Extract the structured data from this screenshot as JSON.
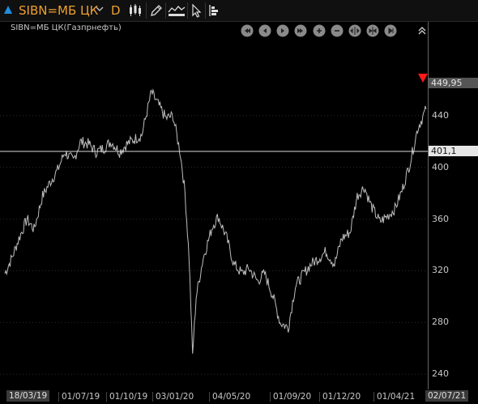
{
  "toolbar": {
    "symbol": "SIBN=МБ ЦК",
    "period": "D",
    "icons": [
      "chevron-down-icon",
      "candlestick-icon",
      "pencil-icon",
      "indicators-icon",
      "cursor-icon",
      "chart-settings-icon"
    ]
  },
  "legend": "SIBN=МБ ЦК(Газпрнефть)",
  "nav_icons": [
    "scroll-start-icon",
    "scroll-left-icon",
    "scroll-right-icon",
    "scroll-end-icon",
    "zoom-in-icon",
    "zoom-out-icon",
    "fit-width-icon",
    "compress-icon",
    "step-end-icon",
    "collapse-up-icon"
  ],
  "price": {
    "last": "449,95",
    "crosshair": "401,1"
  },
  "colors": {
    "accent": "#f0a030",
    "series": "#bdbdbd",
    "last_marker": "#ff1a1a",
    "crosshair": "#d8d8d8"
  },
  "chart_data": {
    "type": "line",
    "title": "SIBN=МБ ЦК(Газпрнефть)",
    "y_ticks": [
      "440",
      "400",
      "360",
      "320",
      "280",
      "240"
    ],
    "x_ticks": [
      "18/03/19",
      "01/07/19",
      "01/10/19",
      "03/01/20",
      "04/05/20",
      "01/09/20",
      "01/12/20",
      "01/04/21",
      "02/07/21"
    ],
    "ylim": [
      232,
      470
    ],
    "x": [
      "2019-03-18",
      "2019-04-01",
      "2019-04-15",
      "2019-05-01",
      "2019-05-15",
      "2019-06-01",
      "2019-06-15",
      "2019-07-01",
      "2019-07-15",
      "2019-08-01",
      "2019-08-15",
      "2019-09-01",
      "2019-09-15",
      "2019-10-01",
      "2019-10-15",
      "2019-11-01",
      "2019-11-15",
      "2019-12-01",
      "2019-12-15",
      "2020-01-03",
      "2020-01-15",
      "2020-02-01",
      "2020-02-15",
      "2020-03-01",
      "2020-03-10",
      "2020-03-18",
      "2020-03-25",
      "2020-04-01",
      "2020-04-15",
      "2020-05-04",
      "2020-05-15",
      "2020-06-01",
      "2020-06-15",
      "2020-07-01",
      "2020-07-15",
      "2020-08-01",
      "2020-08-15",
      "2020-09-01",
      "2020-09-15",
      "2020-10-01",
      "2020-10-15",
      "2020-11-01",
      "2020-11-15",
      "2020-12-01",
      "2020-12-15",
      "2021-01-01",
      "2021-01-15",
      "2021-02-01",
      "2021-02-15",
      "2021-03-01",
      "2021-03-15",
      "2021-04-01",
      "2021-04-15",
      "2021-05-01",
      "2021-05-15",
      "2021-06-01",
      "2021-06-15",
      "2021-07-02"
    ],
    "series": [
      {
        "values": [
          318,
          330,
          345,
          360,
          352,
          378,
          388,
          398,
          412,
          405,
          420,
          418,
          412,
          415,
          420,
          412,
          418,
          422,
          425,
          458,
          450,
          438,
          440,
          410,
          380,
          330,
          255,
          300,
          330,
          355,
          362,
          345,
          325,
          318,
          322,
          312,
          318,
          300,
          280,
          276,
          308,
          318,
          325,
          330,
          335,
          325,
          345,
          350,
          378,
          385,
          370,
          358,
          362,
          368,
          382,
          405,
          430,
          445
        ]
      }
    ]
  }
}
